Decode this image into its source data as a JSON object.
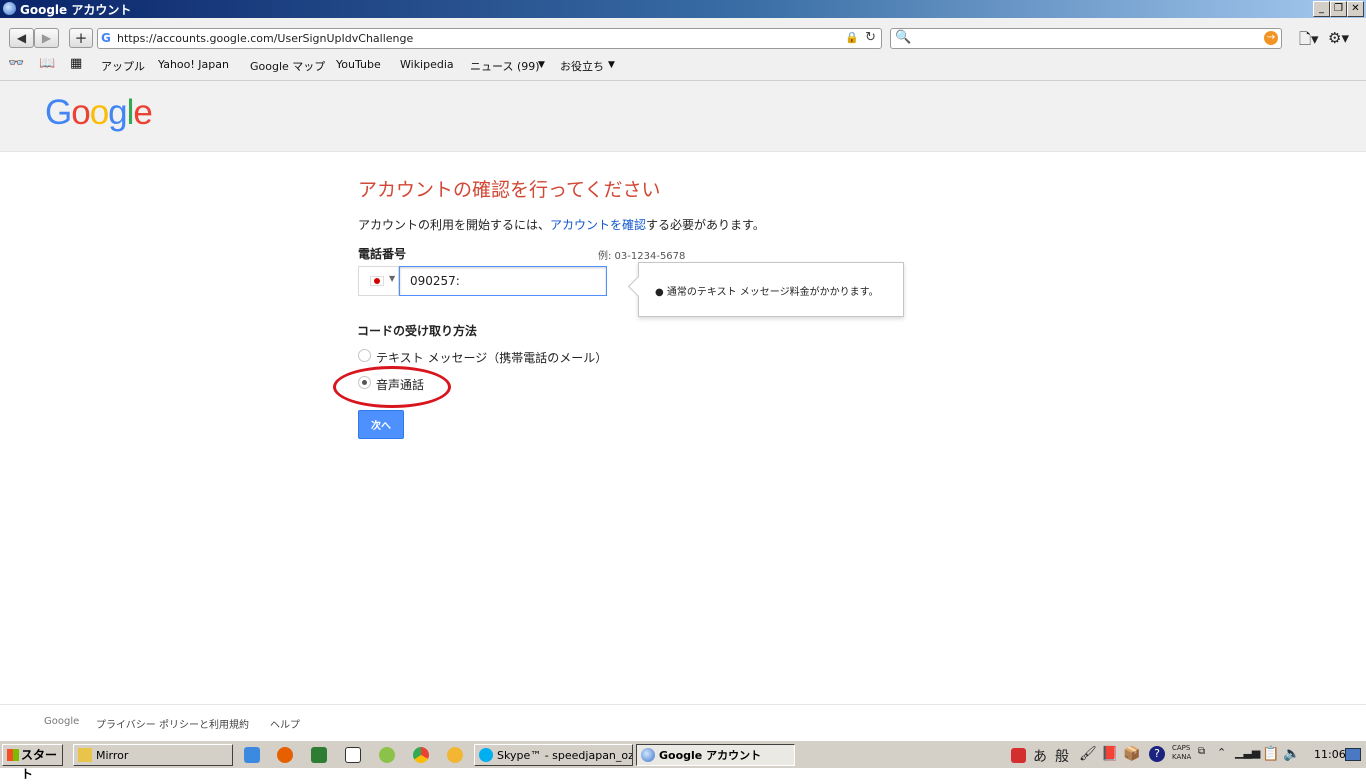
{
  "window": {
    "title": "Google アカウント",
    "controls": [
      "_",
      "❐",
      "✕"
    ]
  },
  "browser": {
    "url": "https://accounts.google.com/UserSignUpIdvChallenge",
    "url_favicon": "G",
    "search_placeholder": "",
    "bookmarks": [
      "アップル",
      "Yahoo! Japan",
      "Google マップ",
      "YouTube",
      "Wikipedia",
      "ニュース (99)",
      "お役立ち"
    ]
  },
  "google": {
    "logo_letters": [
      "G",
      "o",
      "o",
      "g",
      "l",
      "e"
    ],
    "logo_colors": [
      "#4285f4",
      "#ea4335",
      "#fbbc05",
      "#4285f4",
      "#34a853",
      "#ea4335"
    ]
  },
  "form": {
    "heading": "アカウントの確認を行ってください",
    "desc_before": "アカウントの利用を開始するには、",
    "desc_link": "アカウントを確認",
    "desc_after": "する必要があります。",
    "phone_label": "電話番号",
    "phone_example": "例: 03-1234-5678",
    "phone_value": "090257:",
    "tooltip": "通常のテキスト メッセージ料金がかかります。",
    "method_label": "コードの受け取り方法",
    "options": [
      {
        "label": "テキスト メッセージ（携帯電話のメール）",
        "selected": false
      },
      {
        "label": "音声通話",
        "selected": true
      }
    ],
    "next_label": "次へ"
  },
  "footer": {
    "links": [
      "Google",
      "プライバシー ポリシーと利用規約",
      "ヘルプ"
    ]
  },
  "taskbar": {
    "start_label": "スタート",
    "tasks": [
      {
        "label": "Mirror",
        "active": false
      },
      {
        "label": "Skype™ - speedjapan_oz...",
        "active": false
      },
      {
        "label": "Google アカウント",
        "active": true
      }
    ],
    "ime_labels": [
      "あ",
      "般"
    ],
    "caps_text": "CAPS",
    "kana_text": "KANA",
    "clock": "11:06"
  }
}
